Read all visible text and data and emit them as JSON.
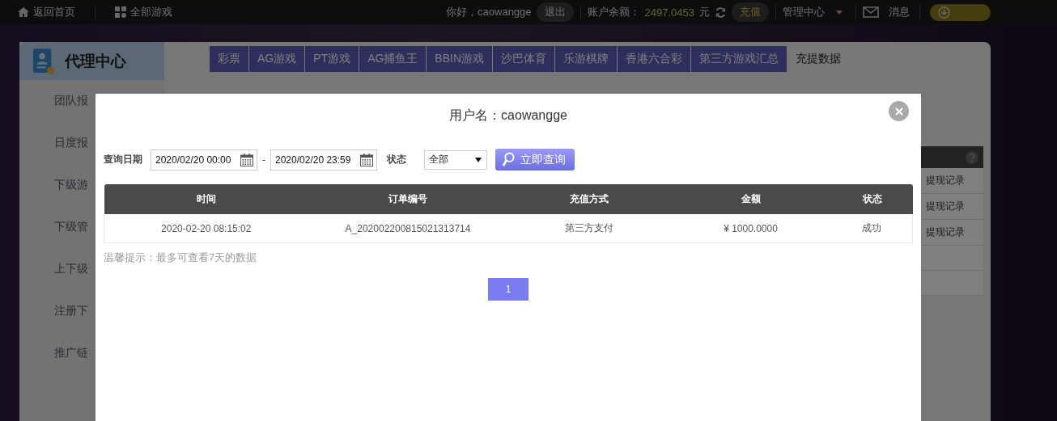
{
  "top_bar": {
    "left": [
      {
        "label": "返回首页",
        "kind": "home"
      },
      {
        "label": "全部游戏",
        "kind": "grid"
      }
    ],
    "greeting": "你好，caowangge",
    "logout": "退出",
    "balance_label": "账户余额：",
    "balance": "2497.0453",
    "currency": "元",
    "recharge": "充值",
    "manage": "管理中心",
    "messages": "消息"
  },
  "panel": {
    "title": "代理中心",
    "tabs": [
      {
        "label": "彩票",
        "selected": false
      },
      {
        "label": "AG游戏",
        "selected": false
      },
      {
        "label": "PT游戏",
        "selected": false
      },
      {
        "label": "AG捕鱼王",
        "selected": false
      },
      {
        "label": "BBIN游戏",
        "selected": false
      },
      {
        "label": "沙巴体育",
        "selected": false
      },
      {
        "label": "乐游棋牌",
        "selected": false
      },
      {
        "label": "香港六合彩",
        "selected": false
      },
      {
        "label": "第三方游戏汇总",
        "selected": false
      },
      {
        "label": "充提数据",
        "selected": true
      }
    ],
    "sidebar": [
      {
        "label": "团队报"
      },
      {
        "label": "日度报"
      },
      {
        "label": "下级游"
      },
      {
        "label": "下级管"
      },
      {
        "label": "上下级"
      },
      {
        "label": "注册下"
      },
      {
        "label": "推广链"
      }
    ],
    "records": [
      "提现记录",
      "提现记录",
      "提现记录"
    ]
  },
  "modal": {
    "title": "用户名：caowangge",
    "date_label": "查询日期",
    "date_from": "2020/02/20 00:00",
    "separator": "-",
    "date_to": "2020/02/20 23:59",
    "status_label": "状态",
    "status_value": "全部",
    "query_button": "立即查询",
    "table": {
      "columns": [
        "时间",
        "订单编号",
        "充值方式",
        "金额",
        "状态"
      ],
      "rows": [
        [
          "2020-02-20 08:15:02",
          "A_202002200815021313714",
          "第三方支付",
          "¥ 1000.0000",
          "成功"
        ]
      ]
    },
    "hint": "温馨提示：最多可查看7天的数据",
    "pages": [
      {
        "label": "1",
        "selected": true
      }
    ]
  }
}
